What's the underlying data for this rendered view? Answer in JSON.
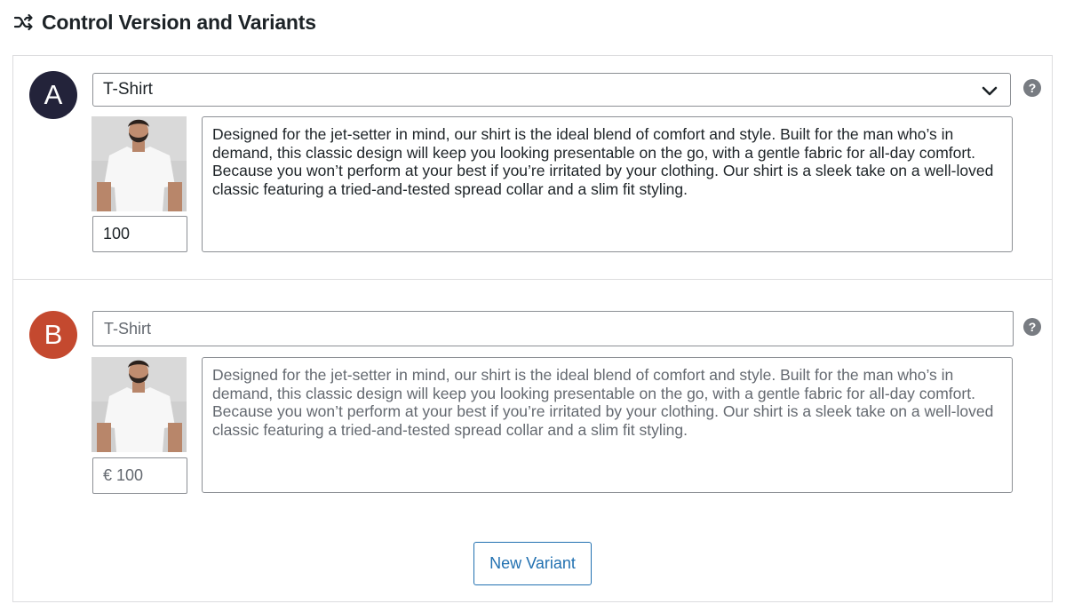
{
  "header": {
    "title": "Control Version and Variants",
    "icon": "shuffle-icon"
  },
  "variants": [
    {
      "badge": "A",
      "badge_color": "#23233a",
      "title_value": "T-Shirt",
      "title_control": "select",
      "price_value": "100",
      "description": "Designed for the jet-setter in mind, our shirt is the ideal blend of comfort and style. Built for the man who’s in demand, this classic design will keep you looking presentable on the go, with a gentle fabric for all-day comfort. Because you won’t perform at your best if you’re irritated by your clothing. Our shirt is a sleek take on a well-loved classic featuring a tried-and-tested spread collar and a slim fit styling.",
      "help_icon": "?"
    },
    {
      "badge": "B",
      "badge_color": "#c4492f",
      "title_placeholder": "T-Shirt",
      "title_control": "text",
      "price_placeholder": "€ 100",
      "description_placeholder": "Designed for the jet-setter in mind, our shirt is the ideal blend of comfort and style. Built for the man who’s in demand, this classic design will keep you looking presentable on the go, with a gentle fabric for all-day comfort. Because you won’t perform at your best if you’re irritated by your clothing. Our shirt is a sleek take on a well-loved classic featuring a tried-and-tested spread collar and a slim fit styling.",
      "help_icon": "?"
    }
  ],
  "actions": {
    "new_variant_label": "New Variant"
  },
  "colors": {
    "accent": "#2271b1",
    "border": "#8c8f94",
    "divider": "#dcdcde"
  }
}
